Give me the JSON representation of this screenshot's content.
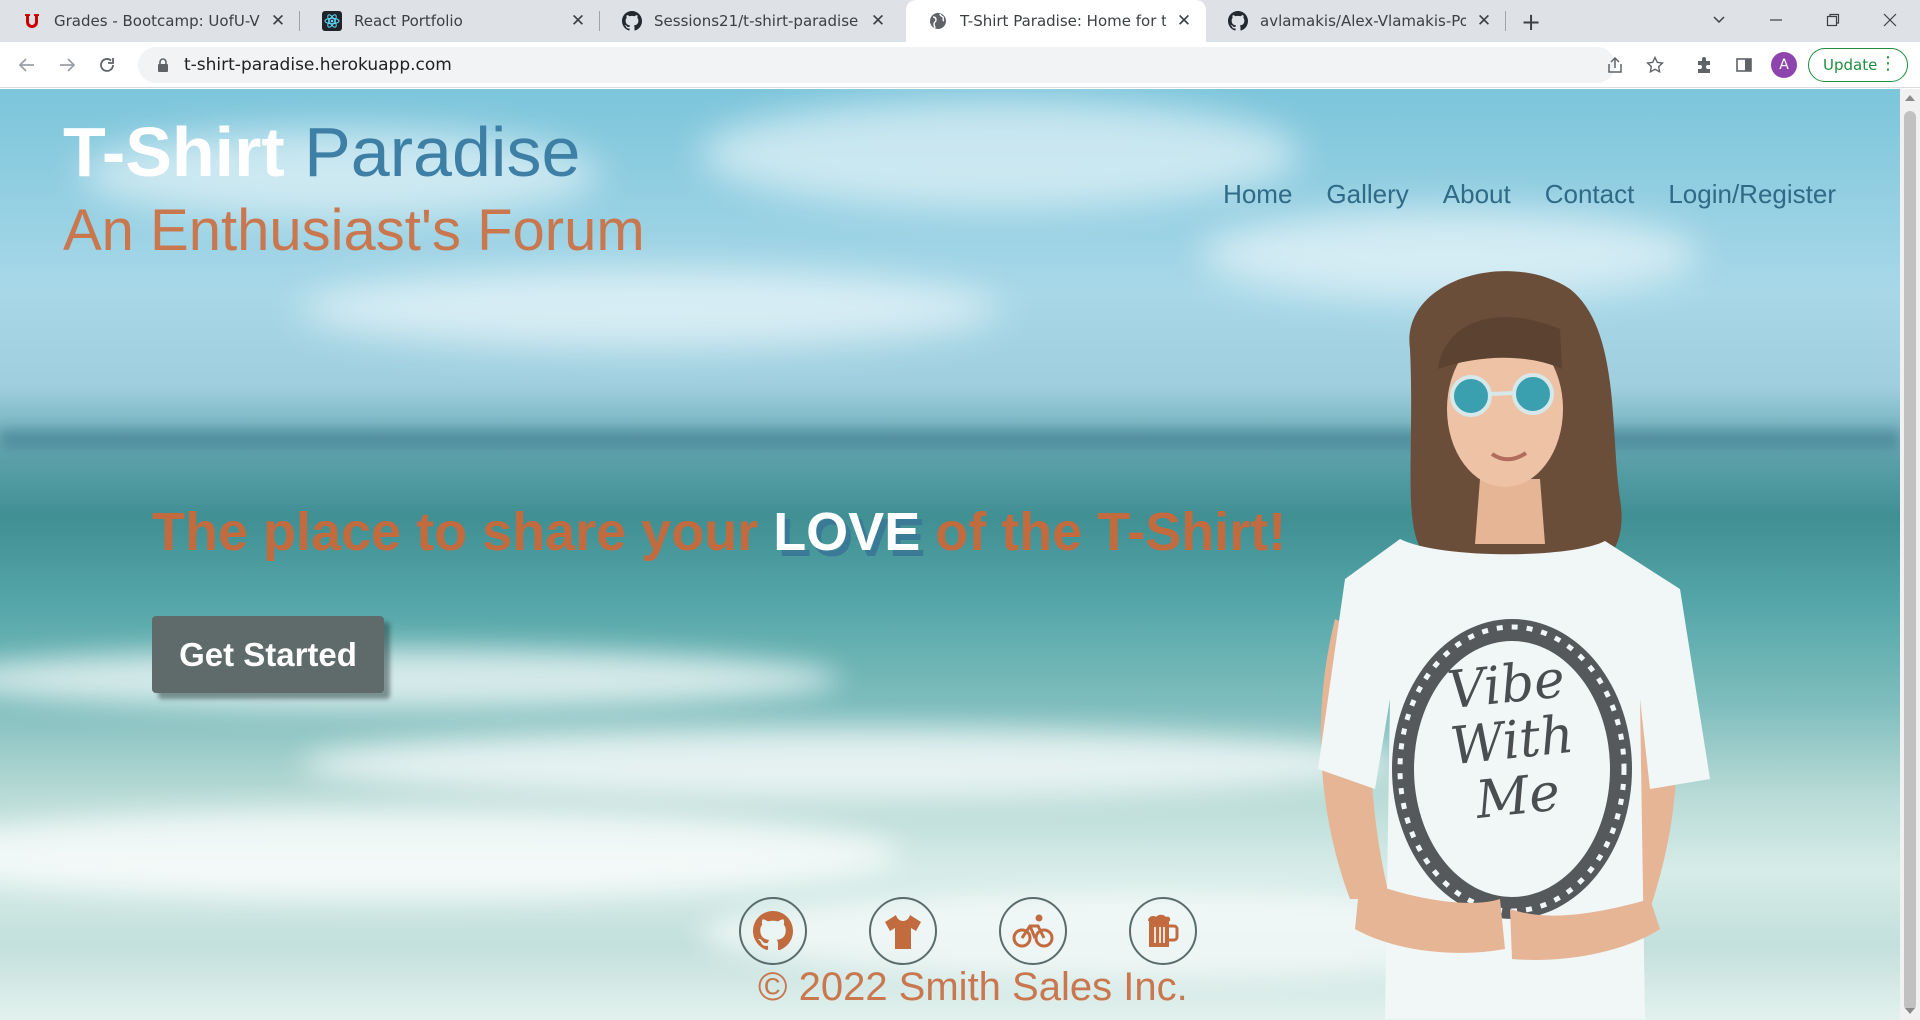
{
  "browser": {
    "tabs": [
      {
        "title": "Grades - Bootcamp: UofU-VIRT-B",
        "icon": "utah-u-icon",
        "active": false
      },
      {
        "title": "React Portfolio",
        "icon": "react-icon",
        "active": false
      },
      {
        "title": "Sessions21/t-shirt-paradise",
        "icon": "github-icon",
        "active": false
      },
      {
        "title": "T-Shirt Paradise: Home for t-shirt",
        "icon": "globe-icon",
        "active": true
      },
      {
        "title": "avlamakis/Alex-Vlamakis-Portfolio",
        "icon": "github-icon",
        "active": false
      }
    ],
    "url": "t-shirt-paradise.herokuapp.com",
    "avatar_letter": "A",
    "update_label": "Update",
    "update_color": "#1e8e3e"
  },
  "site": {
    "brand_part1": "T-Shirt",
    "brand_part2": "Paradise",
    "tagline": "An Enthusiast's Forum",
    "nav": [
      "Home",
      "Gallery",
      "About",
      "Contact",
      "Login/Register"
    ],
    "headline_before": "The place to share your ",
    "headline_love": "LOVE",
    "headline_after": " of the T-Shirt!",
    "cta_label": "Get Started",
    "shirt_text": [
      "Vibe",
      "With",
      "Me"
    ],
    "social_icons": [
      "github-icon",
      "tshirt-icon",
      "bicycle-icon",
      "beer-mug-icon"
    ],
    "footer": "© 2022 Smith Sales Inc.",
    "colors": {
      "brand_white": "#ffffff",
      "brand_blue": "#3d7fa5",
      "accent_orange": "#c8774e",
      "nav_blue": "#2f6a86",
      "button_gray": "#5e6b6a"
    }
  }
}
